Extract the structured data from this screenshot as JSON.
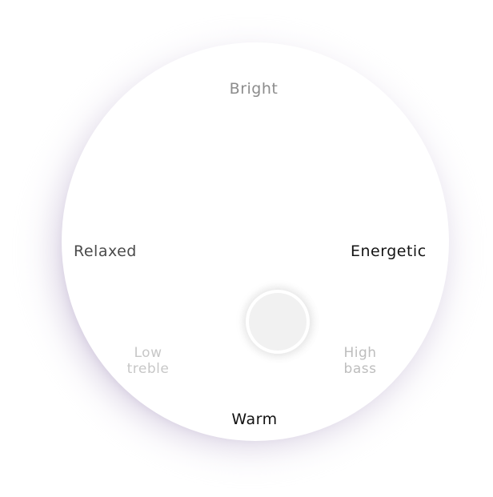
{
  "dial": {
    "labels": {
      "top": "Bright",
      "left": "Relaxed",
      "right": "Energetic",
      "bottom": "Warm",
      "bottom_left": "Low treble",
      "bottom_right": "High bass"
    }
  },
  "colors": {
    "glow": "#765c96",
    "dial_fill": "#ffffff",
    "knob_fill": "#f1f1f1"
  }
}
